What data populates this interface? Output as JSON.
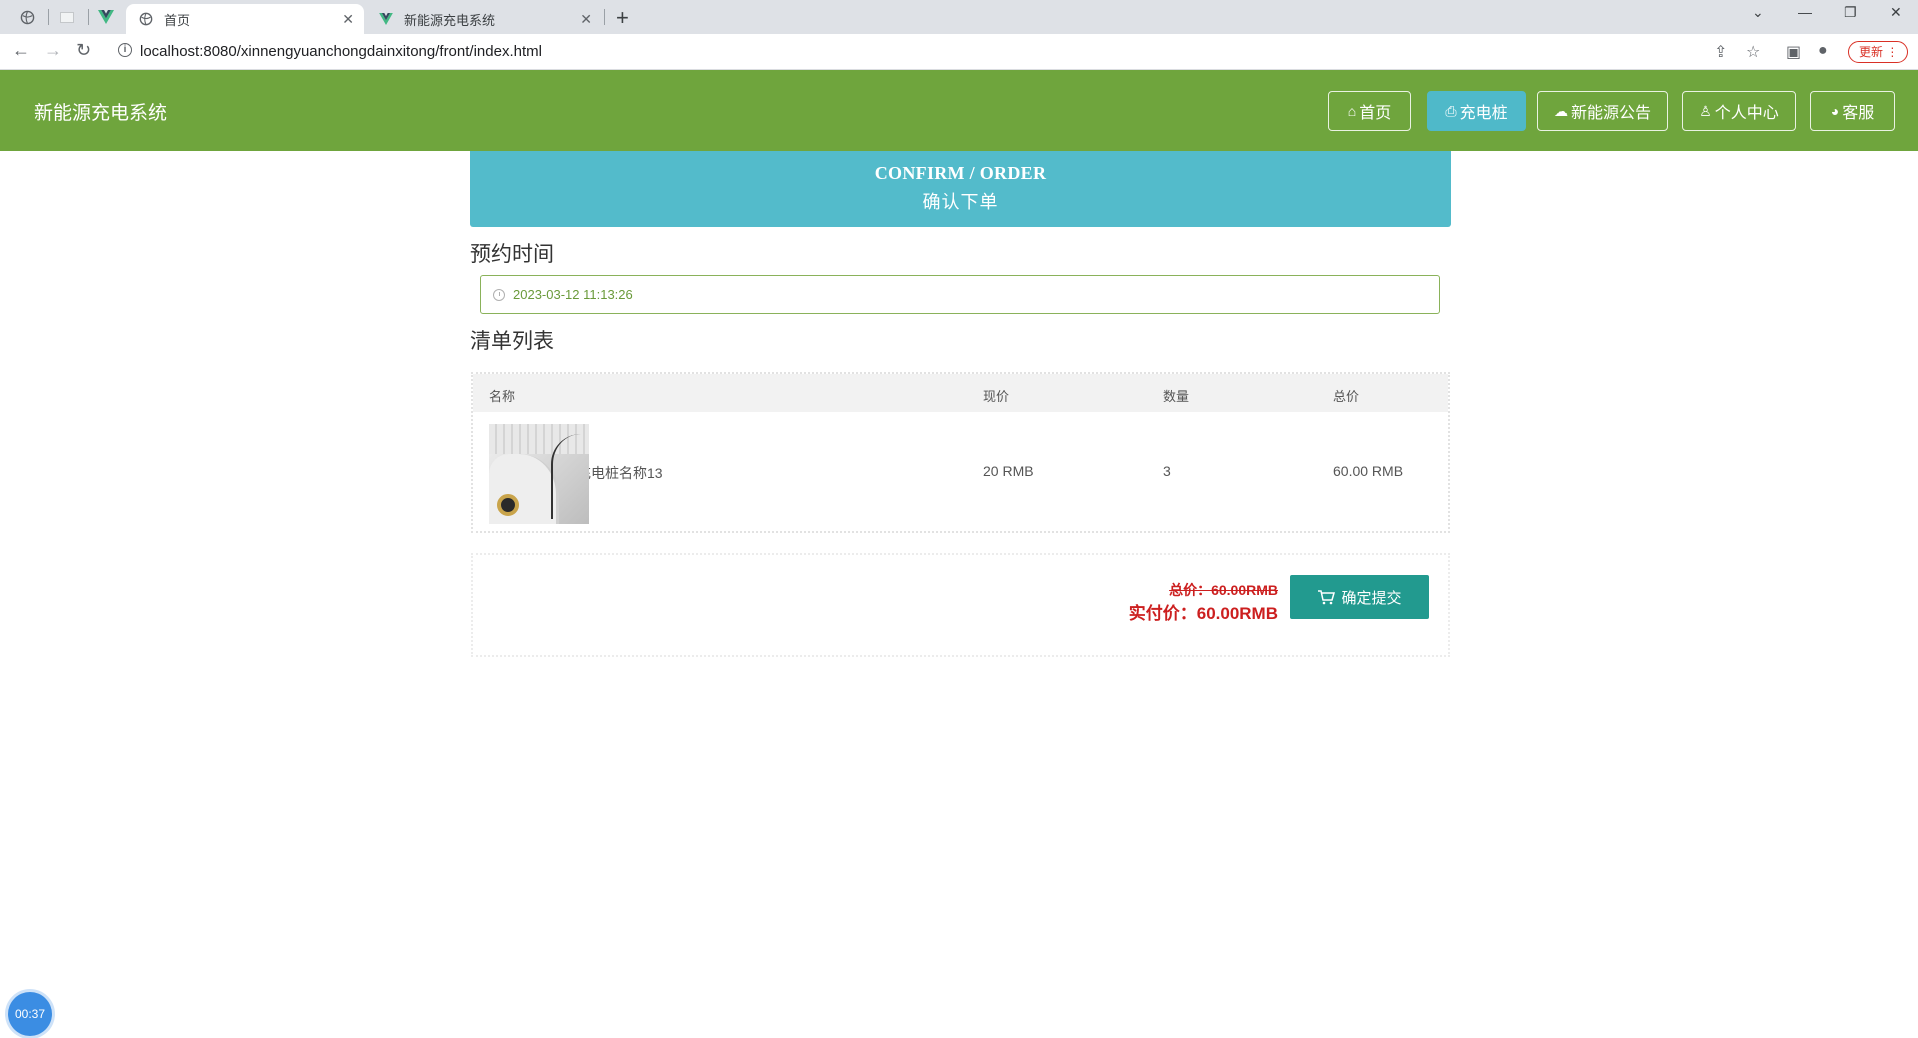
{
  "browser": {
    "tabs": [
      {
        "label": "首页",
        "active": true
      },
      {
        "label": "新能源充电系统",
        "active": false
      }
    ],
    "url": "localhost:8080/xinnengyuanchongdainxitong/front/index.html",
    "update_label": "更新"
  },
  "header": {
    "site_title": "新能源充电系统",
    "nav": [
      {
        "label": "首页",
        "icon": "home-icon",
        "active": false
      },
      {
        "label": "充电桩",
        "icon": "printer-icon",
        "active": true
      },
      {
        "label": "新能源公告",
        "icon": "cloud-icon",
        "active": false
      },
      {
        "label": "个人中心",
        "icon": "user-icon",
        "active": false
      },
      {
        "label": "客服",
        "icon": "chat-icon",
        "active": false
      }
    ]
  },
  "banner": {
    "en": "CONFIRM / ORDER",
    "zh": "确认下单"
  },
  "reservation": {
    "title": "预约时间",
    "value": "2023-03-12 11:13:26"
  },
  "order_list": {
    "title": "清单列表",
    "columns": {
      "name": "名称",
      "price": "现价",
      "qty": "数量",
      "total": "总价"
    },
    "rows": [
      {
        "name": "充电桩名称13",
        "price": "20 RMB",
        "qty": "3",
        "total": "60.00 RMB"
      }
    ]
  },
  "summary": {
    "total_label": "总价：60.00RMB",
    "real_label": "实付价：60.00RMB",
    "submit_label": "确定提交"
  },
  "timer": "00:37",
  "colors": {
    "header_bg": "#6fa53d",
    "banner_bg": "#53bbcb",
    "submit_bg": "#229a8f",
    "price_red": "#cc1f1f"
  }
}
